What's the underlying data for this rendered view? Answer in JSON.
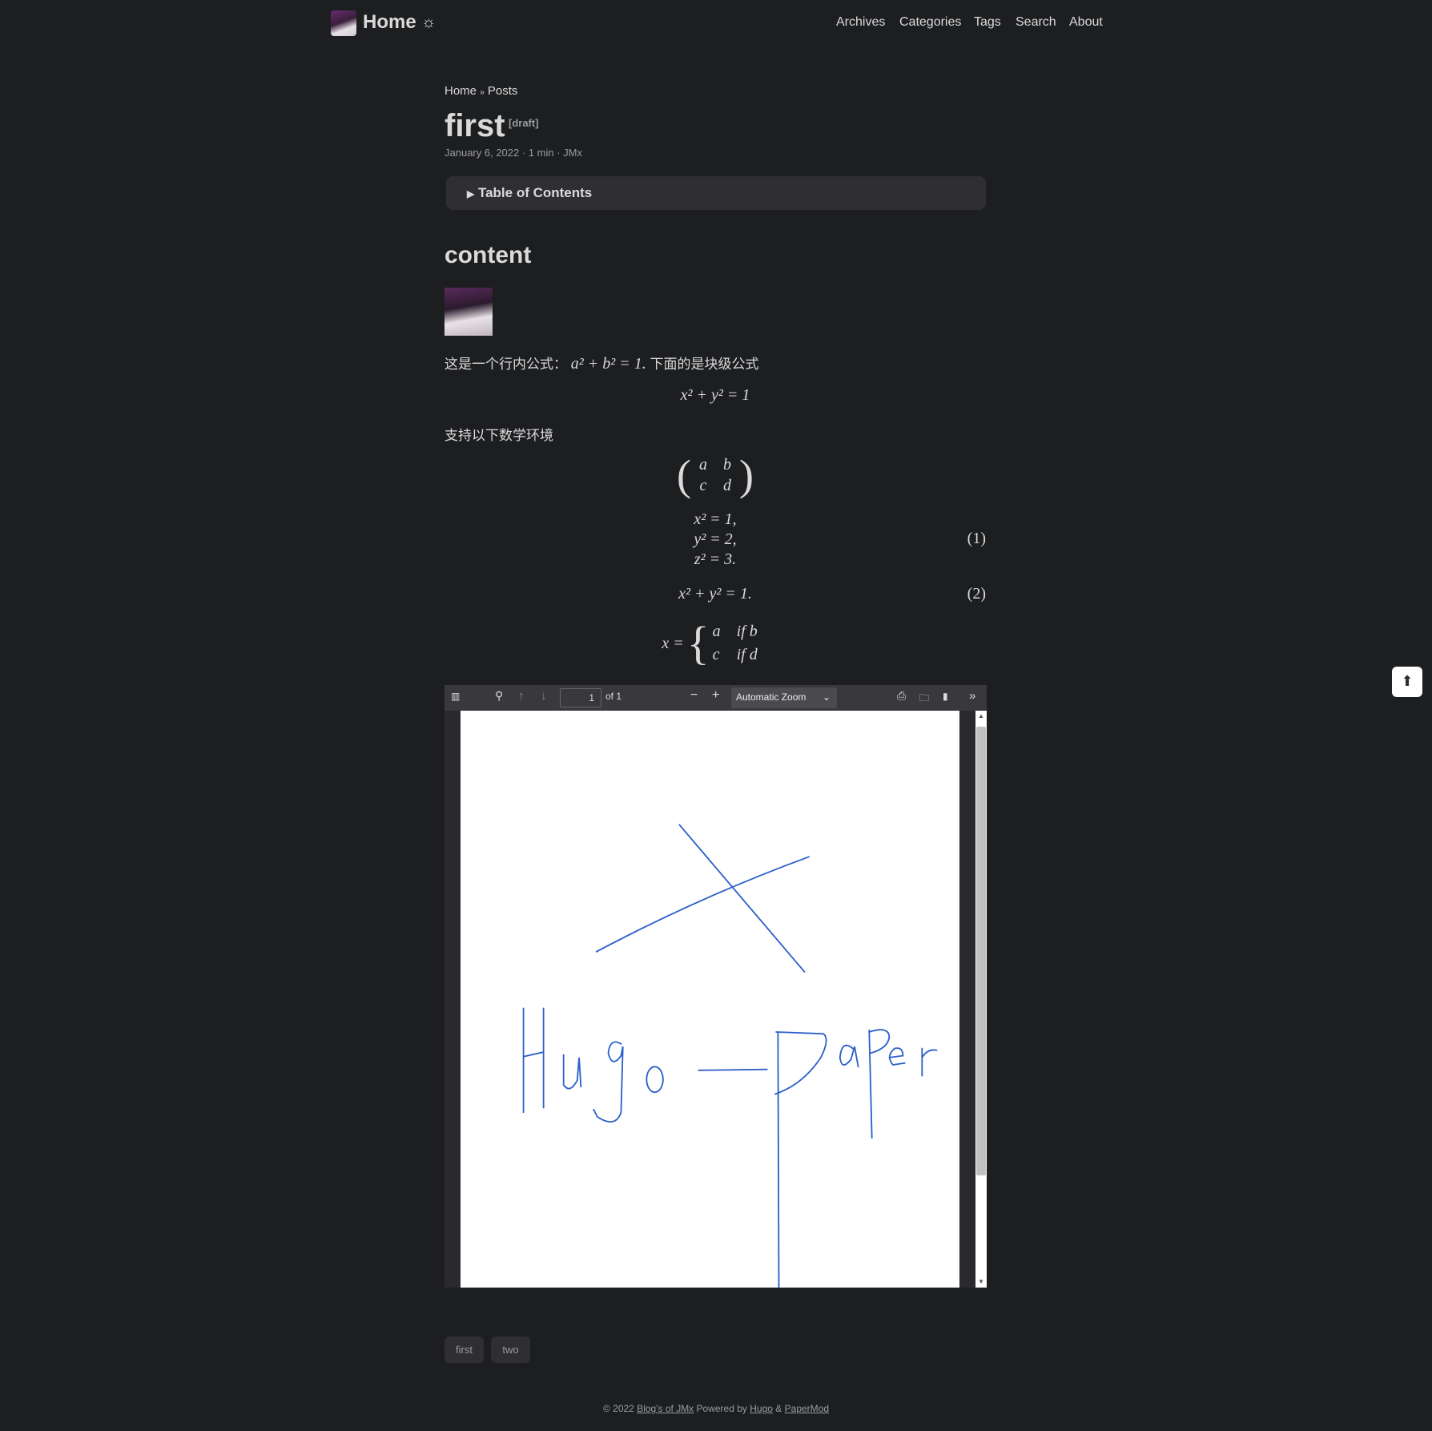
{
  "header": {
    "logo_text": "Home",
    "theme_icon": "sun-icon",
    "nav": [
      "Archives",
      "Categories",
      "Tags",
      "Search",
      "About"
    ]
  },
  "breadcrumb": {
    "home": "Home",
    "sep": "»",
    "posts": "Posts"
  },
  "post": {
    "title": "first",
    "draft": "[draft]",
    "meta": "January 6, 2022 · 1 min · JMx",
    "toc": "Table of Contents",
    "heading": "content",
    "inline_text_before": "这是一个行内公式：",
    "inline_text_after": "下面的是块级公式",
    "env_text": "支持以下数学环境"
  },
  "math": {
    "inline": "a² + b² = 1.",
    "block1": "x² + y² = 1",
    "matrix": [
      "a",
      "b",
      "c",
      "d"
    ],
    "aligned": [
      "x² = 1,",
      "y² = 2,",
      "z² = 3."
    ],
    "eq1": "(1)",
    "eq2_expr": "x² + y² = 1.",
    "eq2": "(2)",
    "cases_lhs": "x =",
    "cases": [
      [
        "a",
        "if b"
      ],
      [
        "c",
        "if d"
      ]
    ]
  },
  "pdf": {
    "page_input": "1",
    "page_count": "of 1",
    "zoom": "Automatic Zoom",
    "stroke_color": "#2b5fc9"
  },
  "tags": [
    "first",
    "two"
  ],
  "footer": {
    "copy": "© 2022",
    "blog": "Blog's of JMx",
    "powered": "Powered by",
    "hugo": "Hugo",
    "amp": "&",
    "papermod": "PaperMod"
  }
}
